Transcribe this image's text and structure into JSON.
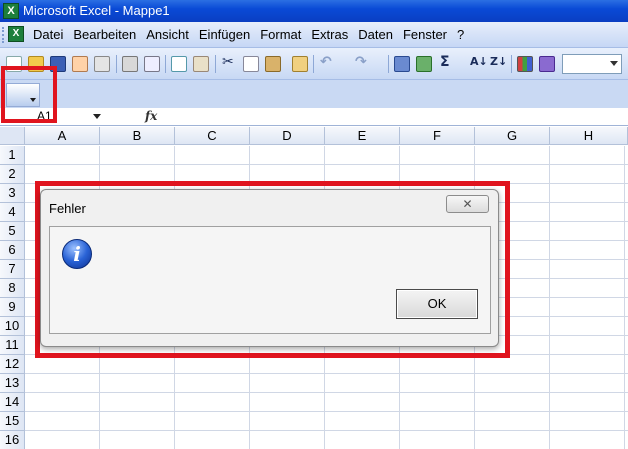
{
  "window": {
    "title": "Microsoft Excel - Mappe1",
    "logo": "X"
  },
  "menu": {
    "items": [
      "Datei",
      "Bearbeiten",
      "Ansicht",
      "Einfügen",
      "Format",
      "Extras",
      "Daten",
      "Fenster",
      "?"
    ]
  },
  "formula_bar": {
    "name_box": "A1",
    "fx_label": "fx"
  },
  "grid": {
    "columns": [
      "A",
      "B",
      "C",
      "D",
      "E",
      "F",
      "G",
      "H"
    ],
    "rows": [
      "1",
      "2",
      "3",
      "4",
      "5",
      "6",
      "7",
      "8",
      "9",
      "10",
      "11",
      "12",
      "13",
      "14",
      "15",
      "16"
    ]
  },
  "dialog": {
    "title": "Fehler",
    "message": "",
    "ok_label": "OK",
    "close_glyph": "✕",
    "icon": "info-icon"
  },
  "colors": {
    "highlight": "#e0141e",
    "titlebar": "#0a4ad6"
  }
}
